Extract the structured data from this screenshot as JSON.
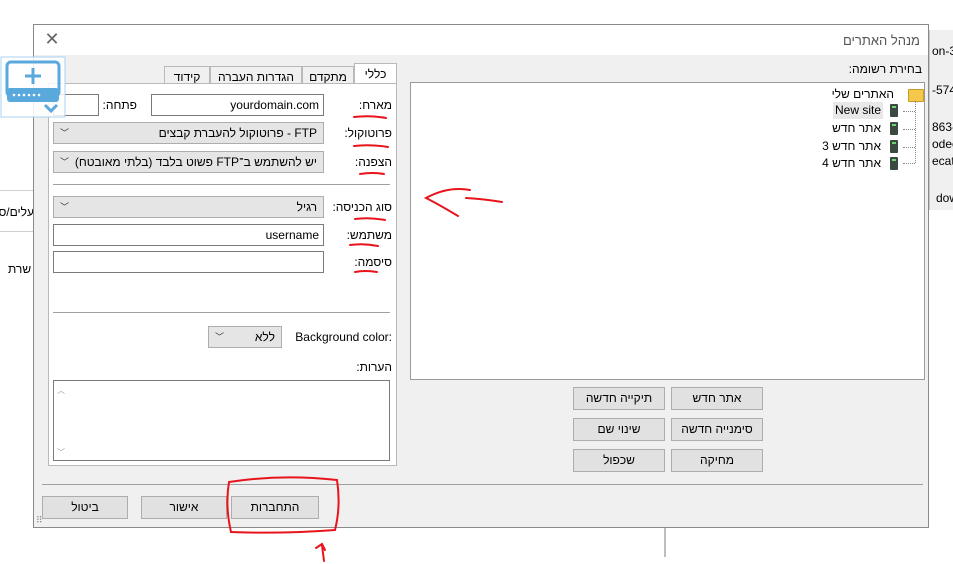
{
  "background": {
    "right_fragments": [
      "on-3",
      "-574",
      "863-",
      "odec",
      "ecat",
      "dow"
    ],
    "left_fragments": [
      "עלים/ס",
      "שרת"
    ]
  },
  "dialog": {
    "title": "מנהל האתרים",
    "close_glyph": "✕"
  },
  "site_list": {
    "label": "בחירת רשומה:",
    "root": "האתרים שלי",
    "items": [
      {
        "label": "New site",
        "selected": true
      },
      {
        "label": "אתר חדש",
        "selected": false
      },
      {
        "label": "אתר חדש 3",
        "selected": false
      },
      {
        "label": "אתר חדש 4",
        "selected": false
      }
    ],
    "buttons": {
      "new_site": "אתר חדש",
      "new_folder": "תיקייה חדשה",
      "new_bookmark": "סימנייה חדשה",
      "rename": "שינוי שם",
      "delete": "מחיקה",
      "duplicate": "שכפול"
    }
  },
  "tabs": [
    {
      "label": "כללי",
      "active": true
    },
    {
      "label": "מתקדם",
      "active": false
    },
    {
      "label": "הגדרות העברה",
      "active": false
    },
    {
      "label": "קידוד",
      "active": false
    }
  ],
  "general": {
    "host_label": "מארח:",
    "host_value": "yourdomain.com",
    "port_label": "פתחה:",
    "port_value": "",
    "protocol_label": "פרוטוקול:",
    "protocol_value": "FTP - פרוטוקול להעברת קבצים",
    "encryption_label": "הצפנה:",
    "encryption_value": "יש להשתמש ב־FTP פשוט בלבד (בלתי מאובטח)",
    "logon_label": "סוג הכניסה:",
    "logon_value": "רגיל",
    "user_label": "משתמש:",
    "user_value": "username",
    "password_label": "סיסמה:",
    "password_value": "",
    "bgcolor_label": "Background color:",
    "bgcolor_value": "ללא",
    "comments_label": "הערות:"
  },
  "footer": {
    "connect": "התחברות",
    "ok": "אישור",
    "cancel": "ביטול"
  },
  "colors": {
    "annotation": "#e8141c",
    "dialog_bg": "#f0f0f0",
    "tool_icon": "#4a9fd8"
  }
}
